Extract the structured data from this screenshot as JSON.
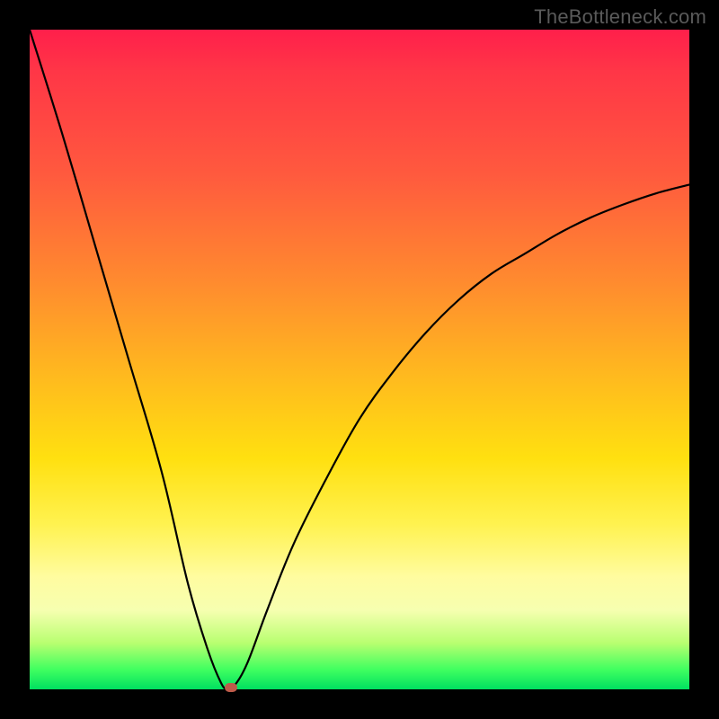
{
  "watermark": {
    "text": "TheBottleneck.com"
  },
  "chart_data": {
    "type": "line",
    "title": "",
    "xlabel": "",
    "ylabel": "",
    "xlim": [
      0,
      100
    ],
    "ylim": [
      0,
      100
    ],
    "grid": false,
    "legend": false,
    "series": [
      {
        "name": "bottleneck-curve",
        "x": [
          0,
          5,
          10,
          15,
          20,
          24,
          27,
          29,
          30,
          31,
          33,
          36,
          40,
          45,
          50,
          55,
          60,
          65,
          70,
          75,
          80,
          85,
          90,
          95,
          100
        ],
        "values": [
          100,
          84,
          67,
          50,
          33,
          16,
          6,
          1,
          0,
          0.5,
          4,
          12,
          22,
          32,
          41,
          48,
          54,
          59,
          63,
          66,
          69,
          71.5,
          73.5,
          75.2,
          76.5
        ]
      }
    ],
    "marker": {
      "x": 30.5,
      "y": 0.3
    },
    "background_gradient": {
      "stops": [
        {
          "pos": 0.0,
          "color": "#ff1f4b"
        },
        {
          "pos": 0.22,
          "color": "#ff5a3e"
        },
        {
          "pos": 0.52,
          "color": "#ffb81f"
        },
        {
          "pos": 0.75,
          "color": "#fff250"
        },
        {
          "pos": 0.93,
          "color": "#b8ff70"
        },
        {
          "pos": 1.0,
          "color": "#00e060"
        }
      ]
    }
  }
}
